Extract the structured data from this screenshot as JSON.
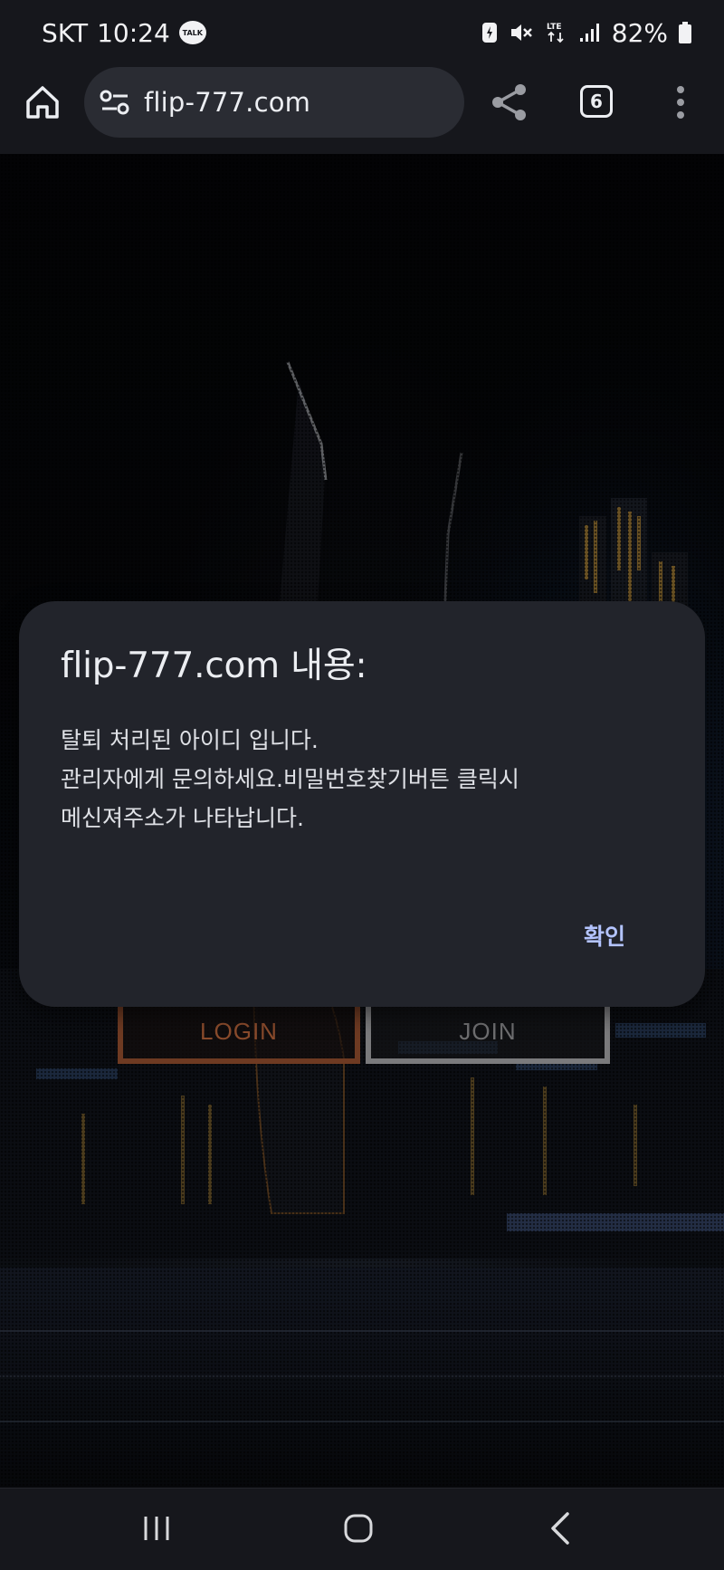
{
  "status_bar": {
    "carrier": "SKT",
    "time": "10:24",
    "talk_badge": "TALK",
    "network": "LTE",
    "battery": "82%"
  },
  "browser": {
    "url": "flip-777.com",
    "tab_count": "6"
  },
  "page": {
    "login_label": "LOGIN",
    "join_label": "JOIN"
  },
  "dialog": {
    "title": "flip-777.com 내용:",
    "lines": [
      "탈퇴 처리된 아이디 입니다.",
      "관리자에게 문의하세요.비밀번호찾기버튼 클릭시",
      "메신져주소가 나타납니다."
    ],
    "ok_label": "확인"
  },
  "colors": {
    "dialog_bg": "#22242b",
    "accent_button": "#b4c4ff",
    "browser_chrome": "#16171c"
  }
}
